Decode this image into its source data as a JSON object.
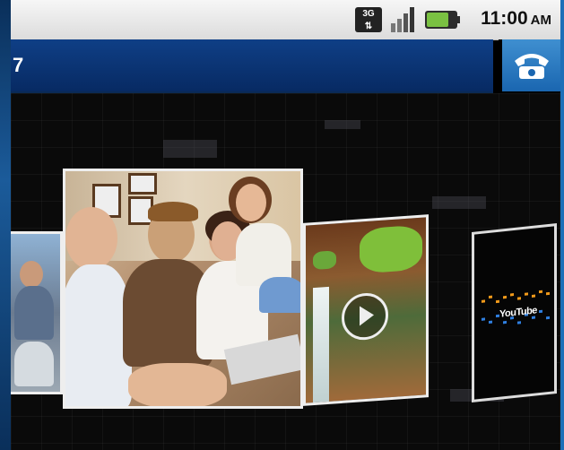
{
  "status_bar": {
    "network_label": "3G",
    "time": "11:00",
    "ampm": "AM"
  },
  "title_bar": {
    "title": "7"
  },
  "carousel": {
    "items": [
      {
        "name": "family-photo-partial",
        "type": "photo"
      },
      {
        "name": "family-photo",
        "type": "photo"
      },
      {
        "name": "waterfall-video",
        "type": "video"
      },
      {
        "name": "youtube",
        "type": "app"
      }
    ]
  },
  "youtube": {
    "logo_text": "YouTube"
  },
  "colors": {
    "title_bar": "#0f3f86",
    "phone_button": "#1a66b0",
    "status_bar": "#e8e8e8",
    "battery": "#7ac142"
  }
}
